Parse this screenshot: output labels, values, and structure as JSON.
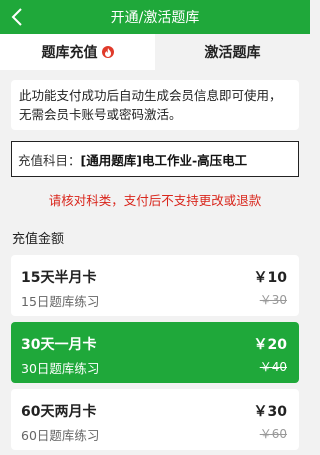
{
  "header": {
    "title": "开通/激活题库"
  },
  "tabs": [
    {
      "label": "题库充值"
    },
    {
      "label": "激活题库"
    }
  ],
  "info": {
    "text": "此功能支付成功后自动生成会员信息即可使用，无需会员卡账号或密码激活。"
  },
  "subject": {
    "label": "充值科目：",
    "value": "[通用题库]电工作业-高压电工"
  },
  "warning": "请核对科类，支付后不支持更改或退款",
  "section_title": "充值金额",
  "plans": [
    {
      "name": "15天半月卡",
      "desc": "15日题库练习",
      "price": "￥10",
      "original": "￥30"
    },
    {
      "name": "30天一月卡",
      "desc": "30日题库练习",
      "price": "￥20",
      "original": "￥40"
    },
    {
      "name": "60天两月卡",
      "desc": "60日题库练习",
      "price": "￥30",
      "original": "￥60"
    }
  ],
  "colors": {
    "brand": "#1fa83a",
    "warning": "#d9261c"
  }
}
